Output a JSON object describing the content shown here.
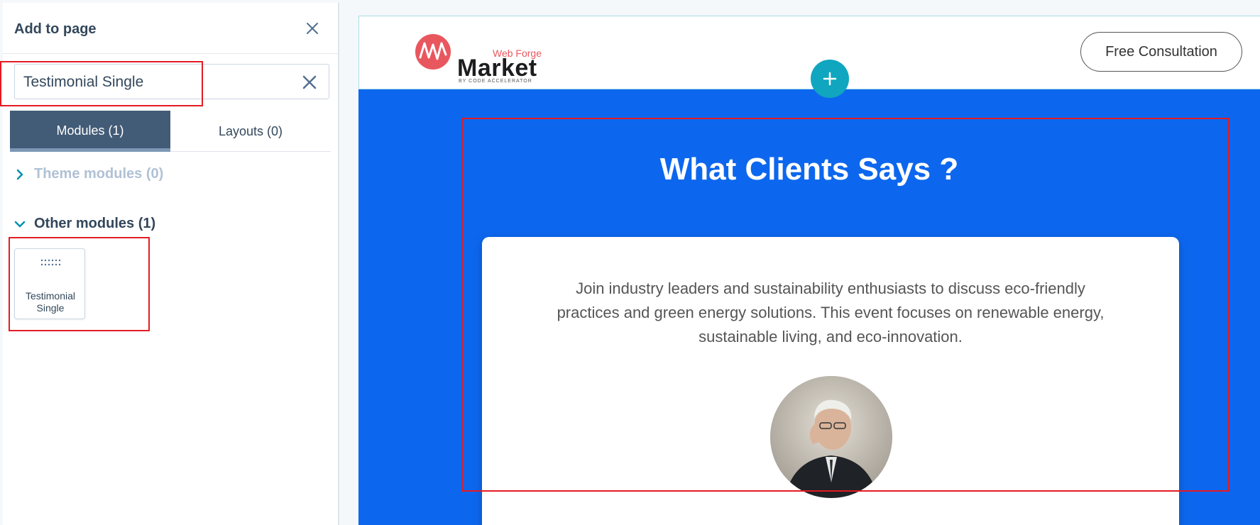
{
  "panel": {
    "title": "Add to page",
    "close_icon": "close-icon",
    "search": {
      "value": "Testimonial Single",
      "clear_icon": "clear-search-icon"
    },
    "tabs": [
      {
        "label": "Modules (1)",
        "active": true
      },
      {
        "label": "Layouts (0)",
        "active": false
      }
    ],
    "sections": [
      {
        "label": "Theme modules (0)",
        "expanded": false,
        "icon": "chevron-right-icon"
      },
      {
        "label": "Other modules (1)",
        "expanded": true,
        "icon": "chevron-down-icon"
      }
    ],
    "module_card": {
      "label": "Testimonial Single",
      "icon": "drag-handle-icon"
    }
  },
  "preview": {
    "header": {
      "logo_sub": "Web Forge",
      "logo_main": "Market",
      "logo_tag": "BY CODE ACCELERATOR",
      "cta_label": "Free Consultation"
    },
    "add_section_icon": "plus-icon",
    "section_heading": "What Clients Says ?",
    "testimonial": {
      "quote": "Join industry leaders and sustainability enthusiasts to discuss eco-friendly practices and green energy solutions. This event focuses on renewable energy, sustainable living, and eco-innovation."
    }
  },
  "colors": {
    "panel_tab_active": "#425b76",
    "section_bg": "#0d67ee",
    "plus_button": "#10a6bf",
    "highlight": "#e31b23",
    "chevron": "#0091ae",
    "logo_red": "#e9575e"
  }
}
